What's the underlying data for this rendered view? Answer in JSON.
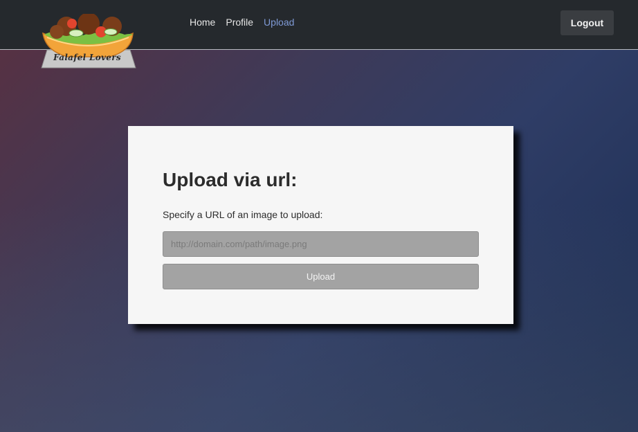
{
  "brand": {
    "logo_text": "Falafel Lovers"
  },
  "nav": {
    "links": [
      {
        "label": "Home",
        "active": false
      },
      {
        "label": "Profile",
        "active": false
      },
      {
        "label": "Upload",
        "active": true
      }
    ],
    "logout_label": "Logout"
  },
  "upload_card": {
    "title": "Upload via url:",
    "description": "Specify a URL of an image to upload:",
    "url_input": {
      "value": "",
      "placeholder": "http://domain.com/path/image.png"
    },
    "submit_label": "Upload"
  },
  "colors": {
    "navbar_bg": "#25292d",
    "active_link": "#7f9ad6",
    "card_bg": "#f6f6f6",
    "control_bg": "#a3a3a3"
  }
}
